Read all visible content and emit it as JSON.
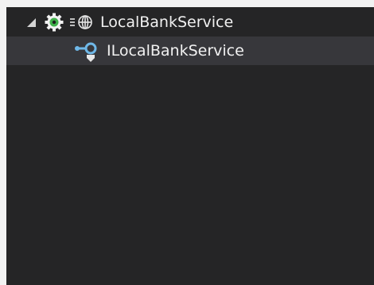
{
  "tree": {
    "root": {
      "label": "LocalBankService",
      "icons": [
        "expanded-triangle-icon",
        "service-gear-icon",
        "web-globe-icon"
      ],
      "expanded": true
    },
    "children": [
      {
        "label": "ILocalBankService",
        "icon": "interface-icon",
        "selected": true
      }
    ]
  },
  "colors": {
    "panel_bg": "#252526",
    "selected_row_bg": "#37373b",
    "text": "#f1f1f1",
    "gear_green": "#3fb04a",
    "interface_blue": "#6fb8e8"
  }
}
